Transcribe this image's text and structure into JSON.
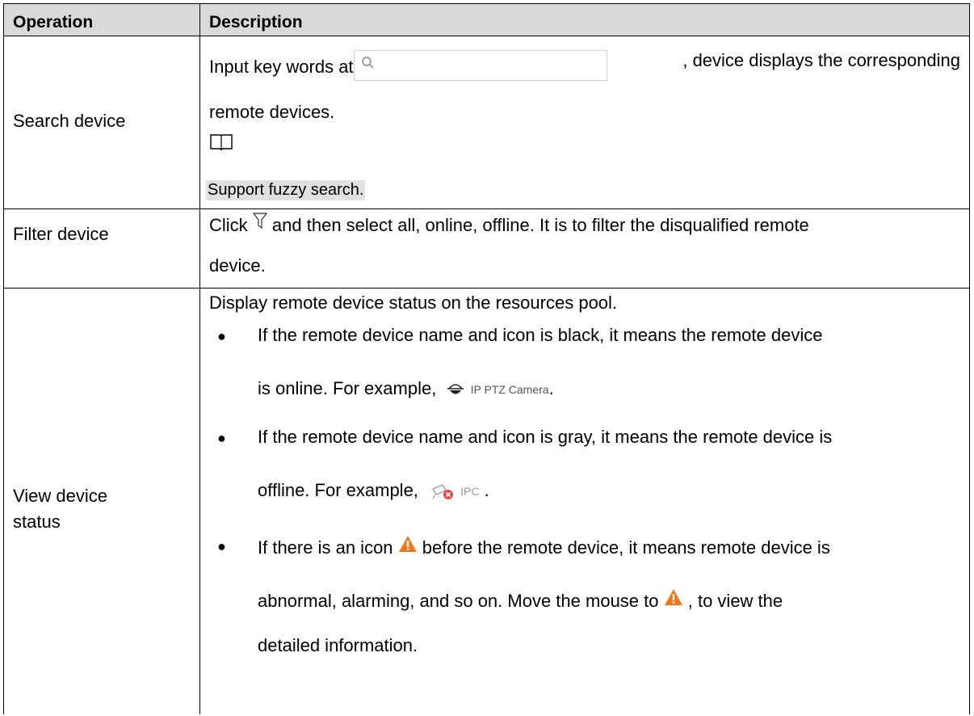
{
  "table": {
    "headers": {
      "operation": "Operation",
      "description": "Description"
    },
    "rows": [
      {
        "operation": "Search device",
        "desc_a": "Input key words at",
        "desc_b": ", device displays the corresponding",
        "desc_c": "remote devices.",
        "note": "Support fuzzy search."
      },
      {
        "operation": "Filter device",
        "desc_a": "Click",
        "desc_b": "and then select all, online, offline. It is to filter the disqualified remote",
        "desc_c": "device."
      },
      {
        "operation_line1": "View device",
        "operation_line2": "status",
        "intro": "Display remote device status on the resources pool.",
        "b1_line1": "If the remote device name and icon is black, it means the remote device",
        "b1_line2": "is online. For example,",
        "b1_example": "IP PTZ Camera",
        "b2_line1": "If the remote device name and icon is gray, it means the remote device is",
        "b2_line2": "offline. For example,",
        "b2_example": "IPC",
        "b3_line1_a": "If there is an icon",
        "b3_line1_b": "before the remote device, it means remote device is",
        "b3_line2_a": "abnormal, alarming, and so on. Move the mouse to",
        "b3_line2_b": ", to view the",
        "b3_line3": "detailed information."
      }
    ]
  },
  "icons": {
    "search": "search-icon",
    "book": "book-icon",
    "filter": "filter-icon",
    "ptz_camera": "ptz-camera-icon",
    "offline_camera": "offline-camera-icon",
    "warning": "warning-icon"
  },
  "colors": {
    "header_bg": "#d9d9d9",
    "note_bg": "#e0e0e0",
    "warning": "#f07818",
    "offline_badge": "#e8464a"
  }
}
